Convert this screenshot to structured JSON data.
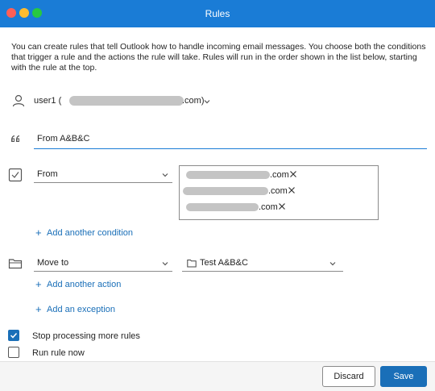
{
  "window": {
    "title": "Rules"
  },
  "description": "You can create rules that tell Outlook how to handle incoming email messages. You choose both the conditions that trigger a rule and the actions the rule will take. Rules will run in the order shown in the list below, starting with the rule at the top.",
  "account": {
    "name": "user1 (",
    "suffix": ".com)",
    "icon": "person-icon"
  },
  "rule_name": {
    "value": "From A&B&C",
    "icon": "quote-icon"
  },
  "condition": {
    "icon": "checkbox-list-icon",
    "field": "From",
    "recipients": [
      {
        "suffix": ".com"
      },
      {
        "suffix": ".com"
      },
      {
        "suffix": ".com"
      }
    ],
    "add_condition_label": "Add another condition"
  },
  "action": {
    "icon": "folder-move-icon",
    "field": "Move to",
    "folder": "Test A&B&C",
    "folder_icon": "folder-icon",
    "add_action_label": "Add another action"
  },
  "add_exception_label": "Add an exception",
  "options": {
    "stop_processing": {
      "label": "Stop processing more rules",
      "checked": true
    },
    "run_now": {
      "label": "Run rule now",
      "checked": false
    }
  },
  "buttons": {
    "discard": "Discard",
    "save": "Save"
  },
  "colors": {
    "accent": "#1a6fb8",
    "titlebar": "#1a7cd6",
    "redacted": "#c4c4c4"
  }
}
